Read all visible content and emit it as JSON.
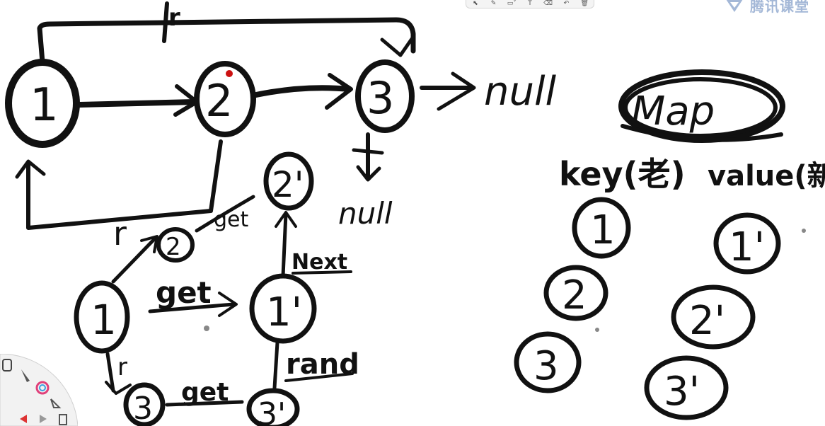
{
  "toolbar": {
    "tools": [
      {
        "name": "pointer-icon",
        "glyph": "⬉"
      },
      {
        "name": "pen-icon",
        "glyph": "✎"
      },
      {
        "name": "shape-icon",
        "glyph": "▭˅"
      },
      {
        "name": "text-icon",
        "glyph": "T"
      },
      {
        "name": "eraser-icon",
        "glyph": "⌫"
      },
      {
        "name": "undo-icon",
        "glyph": "↶"
      },
      {
        "name": "trash-icon",
        "glyph": "🗑"
      }
    ]
  },
  "brand": {
    "text": "腾讯课堂",
    "color": "#5a7fb8"
  },
  "left_diagram": {
    "node1": "1",
    "node2": "2",
    "node3": "3",
    "null_right": "null",
    "null_below": "null",
    "copy2": "2'",
    "small2": "2",
    "bottom1": "1",
    "copy1": "1'",
    "bottom3": "3",
    "copy3": "3'",
    "label_top_r": "r",
    "label_loop_r": "r",
    "label_bottom_r": "r",
    "label_get1": "get",
    "label_get2": "get",
    "label_get3": "get",
    "label_next": "Next",
    "label_rand": "rand"
  },
  "right_diagram": {
    "title": "Map",
    "key_header": "key(老)",
    "value_header": "value(新)",
    "keys": [
      "1",
      "2",
      "3"
    ],
    "values": [
      "1'",
      "2'",
      "3'"
    ]
  },
  "colors": {
    "ink": "#111111",
    "dot": "#cc1111"
  }
}
